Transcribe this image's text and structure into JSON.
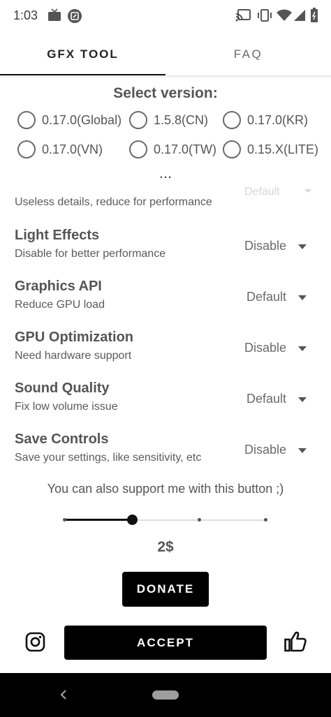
{
  "status_bar": {
    "time": "1:03"
  },
  "tabs": [
    {
      "label": "GFX TOOL",
      "active": true
    },
    {
      "label": "FAQ",
      "active": false
    }
  ],
  "version": {
    "title": "Select version:",
    "options": [
      "0.17.0(Global)",
      "1.5.8(CN)",
      "0.17.0(KR)",
      "0.17.0(VN)",
      "0.17.0(TW)",
      "0.15.X(LITE)"
    ],
    "more": "..."
  },
  "partial_setting": {
    "value": "Default",
    "desc": "Useless details, reduce for performance"
  },
  "settings": [
    {
      "title": "Light Effects",
      "desc": "Disable for better performance",
      "value": "Disable"
    },
    {
      "title": "Graphics API",
      "desc": "Reduce GPU load",
      "value": "Default"
    },
    {
      "title": "GPU Optimization",
      "desc": "Need hardware support",
      "value": "Disable"
    },
    {
      "title": "Sound Quality",
      "desc": "Fix low volume issue",
      "value": "Default"
    },
    {
      "title": "Save Controls",
      "desc": "Save your settings, like sensitivity, etc",
      "value": "Disable"
    }
  ],
  "support": {
    "text": "You can also support me with this button ;)",
    "amount": "2$",
    "slider_step": 1,
    "slider_steps": 4
  },
  "buttons": {
    "donate": "DONATE",
    "accept": "ACCEPT"
  },
  "icons": [
    "cast-icon",
    "vibrate-icon",
    "wifi-icon",
    "signal-icon",
    "battery-icon",
    "instagram-icon",
    "thumbs-up-icon"
  ],
  "colors": {
    "accent": "#000000",
    "text": "#555555"
  }
}
